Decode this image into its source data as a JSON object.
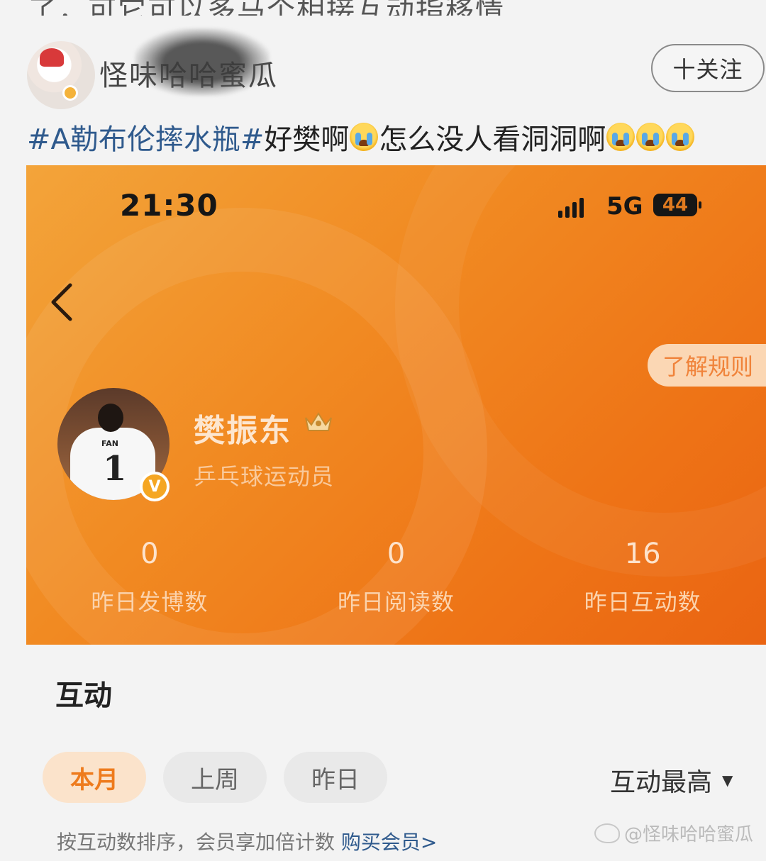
{
  "post": {
    "cut_line": "了，可它可以多马个相接互动指移情……",
    "username": "怪味哈哈蜜瓜",
    "follow_label": "十关注",
    "hashtag": "#A勒布伦摔水瓶#",
    "text_part1": "好樊啊",
    "text_part2": "怎么没人看洞洞啊"
  },
  "card": {
    "status_time": "21:30",
    "network": "5G",
    "battery": "44",
    "rules_label": "了解规则",
    "athlete_name": "樊振东",
    "athlete_role": "乒乓球运动员",
    "jersey_number": "1",
    "jersey_name": "FAN",
    "verified_mark": "V",
    "stats": [
      {
        "value": "0",
        "label": "昨日发博数"
      },
      {
        "value": "0",
        "label": "昨日阅读数"
      },
      {
        "value": "16",
        "label": "昨日互动数"
      }
    ]
  },
  "interaction": {
    "title": "互动",
    "tabs": [
      {
        "label": "本月",
        "active": true
      },
      {
        "label": "上周",
        "active": false
      },
      {
        "label": "昨日",
        "active": false
      }
    ],
    "sort_label": "互动最高",
    "footnote": "按互动数排序，会员享加倍计数",
    "buy_link": "购买会员>"
  },
  "watermark": "@怪味哈哈蜜瓜",
  "colors": {
    "card_orange": "#f18a22",
    "hashtag_blue": "#2f5a8d",
    "active_tab_text": "#ee7b1d"
  }
}
